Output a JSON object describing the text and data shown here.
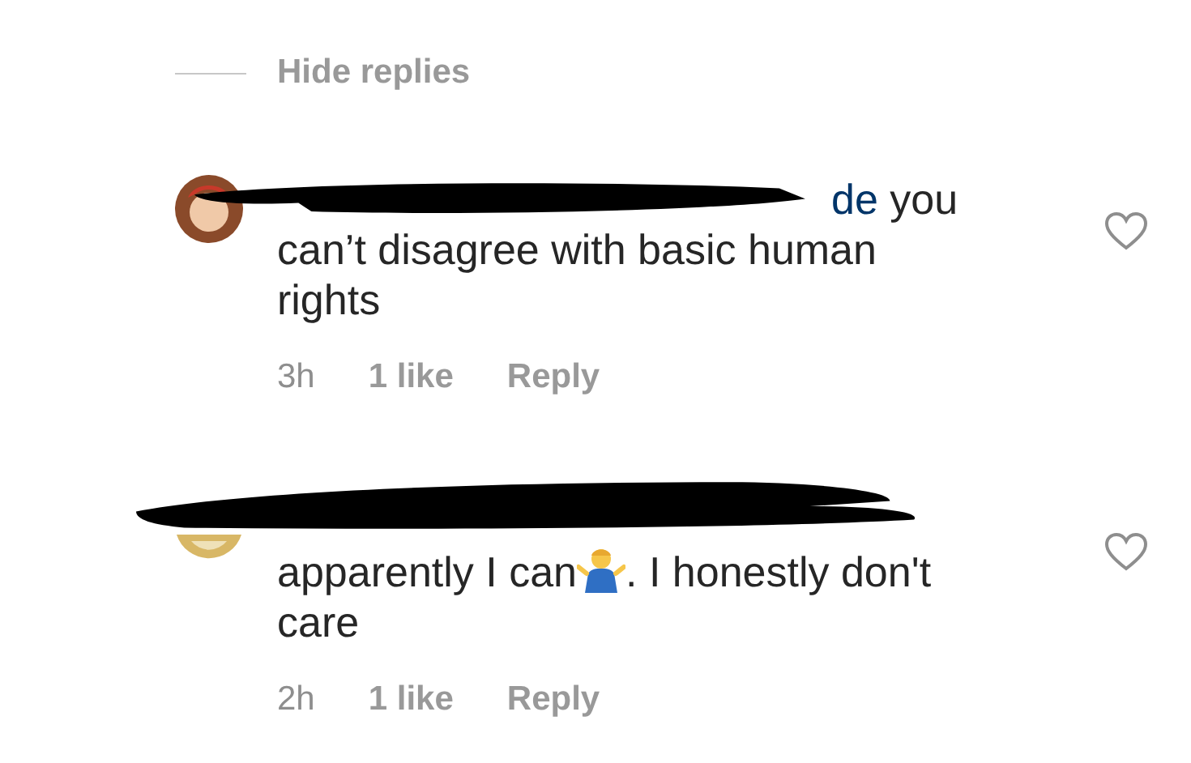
{
  "hide_replies": "Hide replies",
  "comments": [
    {
      "lead": [
        {
          "kind": "mention",
          "text": "de"
        },
        {
          "kind": "text",
          "text": " you"
        }
      ],
      "segments": [
        {
          "kind": "text",
          "text": "can’t disagree with basic human rights"
        }
      ],
      "time": "3h",
      "likes": "1 like",
      "reply": "Reply",
      "liked": false
    },
    {
      "segments": [
        {
          "kind": "text",
          "text": "apparently I can"
        },
        {
          "kind": "emoji"
        },
        {
          "kind": "text",
          "text": ". I honestly don't care"
        }
      ],
      "time": "2h",
      "likes": "1 like",
      "reply": "Reply",
      "liked": false
    }
  ]
}
